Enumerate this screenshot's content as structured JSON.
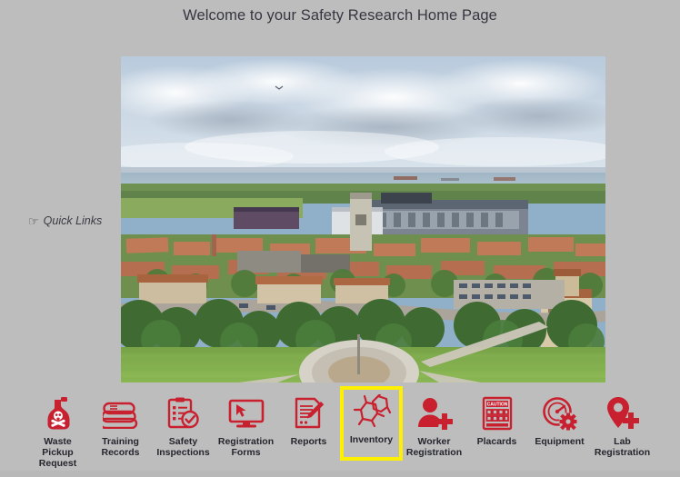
{
  "header": {
    "title": "Welcome to your Safety Research Home Page"
  },
  "quick_links": {
    "icon": "pointing-hand-icon",
    "glyph": "☞",
    "label": "Quick Links"
  },
  "hero": {
    "icon": "aerial-campus-photo",
    "alt": "Aerial photograph of a university campus with stadium, red tile roof buildings, green lawn and circular memorial plaza"
  },
  "colors": {
    "background": "#bdbdbd",
    "brand_red": "#c8202e",
    "highlight_yellow": "#ffef00",
    "label_text": "#25252e",
    "title_text": "#363640"
  },
  "tiles": [
    {
      "label": "Waste Pickup\nRequest",
      "icon": "hazard-jug-skull-icon",
      "selected": false
    },
    {
      "label": "Training\nRecords",
      "icon": "stacked-books-icon",
      "selected": false
    },
    {
      "label": "Safety\nInspections",
      "icon": "clipboard-check-icon",
      "selected": false
    },
    {
      "label": "Registration\nForms",
      "icon": "monitor-cursor-icon",
      "selected": false
    },
    {
      "label": "Reports",
      "icon": "document-pencil-icon",
      "selected": false
    },
    {
      "label": "Inventory",
      "icon": "molecule-icon",
      "selected": true
    },
    {
      "label": "Worker\nRegistration",
      "icon": "person-plus-icon",
      "selected": false
    },
    {
      "label": "Placards",
      "icon": "caution-placard-icon",
      "selected": false
    },
    {
      "label": "Equipment",
      "icon": "gauge-gear-icon",
      "selected": false
    },
    {
      "label": "Lab\nRegistration",
      "icon": "map-pin-plus-icon",
      "selected": false
    }
  ],
  "placard": {
    "caution_text": "CAUTION"
  }
}
